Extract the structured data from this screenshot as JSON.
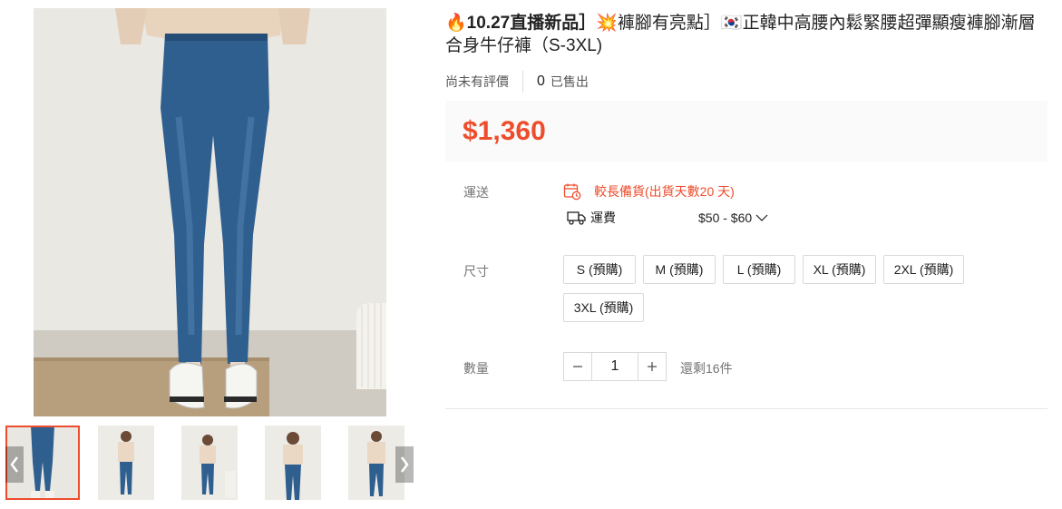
{
  "product": {
    "title_part1": "10.27直播新品］",
    "title_part2": "褲腳有亮點］",
    "title_part3": "正韓中高腰內鬆緊腰超彈顯瘦褲腳漸層合身牛仔褲（S-3XL)",
    "rating_text": "尚未有評價",
    "sold_count": "0",
    "sold_label": "已售出",
    "price": "$1,360"
  },
  "shipping": {
    "label": "運送",
    "preorder_text": "較長備貨(出貨天數20 天)",
    "fee_label": "運費",
    "fee_range": "$50 - $60"
  },
  "sizes": {
    "label": "尺寸",
    "options": [
      "S (預購)",
      "M (預購)",
      "L (預購)",
      "XL (預購)",
      "2XL (預購)",
      "3XL (預購)"
    ]
  },
  "quantity": {
    "label": "數量",
    "value": "1",
    "stock_text": "還剩16件"
  },
  "colors": {
    "accent": "#ee4d2d",
    "muted": "#757575",
    "price_bg": "#fafafa"
  },
  "icons": [
    "fire-icon",
    "explosion-icon",
    "korea-flag-icon",
    "calendar-clock-icon",
    "truck-icon",
    "chevron-down-icon",
    "minus-icon",
    "plus-icon",
    "chevron-left-icon",
    "chevron-right-icon"
  ]
}
